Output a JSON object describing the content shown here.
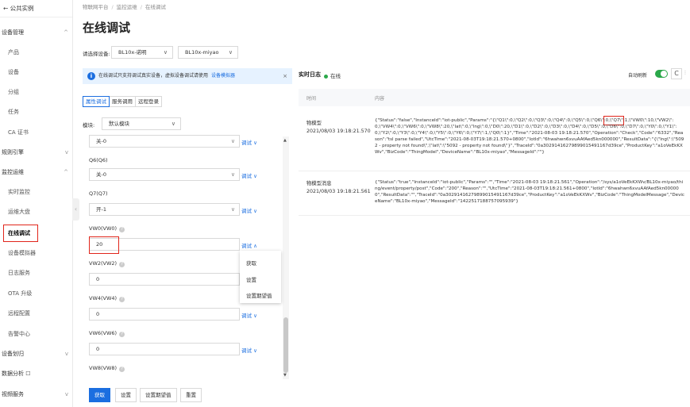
{
  "sidebar": {
    "back_label": "← 公共实例",
    "items": [
      {
        "label": "设备管理",
        "type": "group",
        "chevron": "^"
      },
      {
        "label": "产品",
        "type": "sub"
      },
      {
        "label": "设备",
        "type": "sub"
      },
      {
        "label": "分组",
        "type": "sub"
      },
      {
        "label": "任务",
        "type": "sub"
      },
      {
        "label": "CA 证书",
        "type": "sub"
      },
      {
        "label": "规则引擎",
        "type": "group",
        "chevron": "v"
      },
      {
        "label": "监控运维",
        "type": "group",
        "chevron": "^"
      },
      {
        "label": "实时监控",
        "type": "sub"
      },
      {
        "label": "运维大盘",
        "type": "sub"
      },
      {
        "label": "在线调试",
        "type": "active"
      },
      {
        "label": "设备模拟器",
        "type": "sub"
      },
      {
        "label": "日志服务",
        "type": "sub"
      },
      {
        "label": "OTA 升级",
        "type": "sub"
      },
      {
        "label": "远程配置",
        "type": "sub"
      },
      {
        "label": "告警中心",
        "type": "sub"
      },
      {
        "label": "设备划归",
        "type": "group",
        "chevron": "v"
      },
      {
        "label": "数据分析 ☐",
        "type": "group"
      },
      {
        "label": "视频服务",
        "type": "group",
        "chevron": "v"
      }
    ]
  },
  "breadcrumb": [
    "物联网平台",
    "监控运维",
    "在线调试"
  ],
  "page_title": "在线调试",
  "device_select": {
    "label": "请选择设备:",
    "product": "BL10x-诺明",
    "device": "BL10x-miyao"
  },
  "banner": {
    "text": "在线调试只支持调试真实设备，虚拟设备调试请使用",
    "link": "设备模拟器",
    "close": "×"
  },
  "tabs": [
    "属性调试",
    "服务调用",
    "远程登录"
  ],
  "module": {
    "label": "模块:",
    "value": "默认模块"
  },
  "fields": [
    {
      "label": "",
      "value": "关-0",
      "kind": "select"
    },
    {
      "label": "Q6(Q6)",
      "value": "关-0",
      "kind": "select"
    },
    {
      "label": "Q7(Q7)",
      "value": "开-1",
      "kind": "select"
    },
    {
      "label": "VW0(VW0)",
      "value": "20",
      "kind": "input"
    },
    {
      "label": "VW2(VW2)",
      "value": "0",
      "kind": "input"
    },
    {
      "label": "VW4(VW4)",
      "value": "0",
      "kind": "input"
    },
    {
      "label": "VW6(VW6)",
      "value": "0",
      "kind": "input"
    },
    {
      "label": "VW8(VW8)",
      "value": "",
      "kind": "input"
    }
  ],
  "debug_label": "调试",
  "dropdown": [
    "获取",
    "设置",
    "设置期望值"
  ],
  "buttons": [
    "获取",
    "设置",
    "设置期望值",
    "重置"
  ],
  "log": {
    "title": "实时日志",
    "status": "在线",
    "auto_refresh": "自动刷新",
    "refresh": "C",
    "more": "⫶",
    "columns": [
      "时间",
      "内容"
    ],
    "rows": [
      {
        "type": "物模型",
        "time": "2021/08/03 19:18:21.570",
        "content": "{\"Status\":\"false\",\"InstanceId\":\"iot-public\",\"Params\":\"{\\\"Q1\\\":0,\\\"Q2\\\":0,\\\"Q3\\\":0,\\\"Q4\\\":0,\\\"Q5\\\":0,\\\"Q6\\\":0,\\\"Q7\\\":1,\\\"VW0\\\":10,\\\"VW2\\\":0,\\\"VW4\\\":0,\\\"VW6\\\":0,\\\"VW8\\\":20,\\\"lat\\\":0,\\\"lng\\\":0,\\\"D0\\\":20,\\\"D1\\\":0,\\\"D2\\\":0,\\\"D3\\\":0,\\\"D4\\\":0,\\\"D5\\\":0,\\\"D6\\\":0,\\\"D7\\\":0,\\\"Y0\\\":0,\\\"Y1\\\":0,\\\"Y2\\\":0,\\\"Y3\\\":0,\\\"Y4\\\":0,\\\"Y5\\\":0,\\\"Y6\\\":0,\\\"Y7\\\":1,\\\"Q0\\\":1}\",\"Time\":\"2021-08-03 19:18:21.570\",\"Operation\":\"Check\",\"Code\":\"6332\",\"Reason\":\"tsl parse failed\",\"UtcTime\":\"2021-08-03T19:18:21.570+0800\",\"IotId\":\"6hwahwn6xvuAAfAed5kn000000\",\"ResultData\":\"{\\\"lng\\\":\\\"5092 - property not found\\\",\\\"lat\\\":\\\"5092 - property not found\\\"}\",\"TraceId\":\"0a30291416279899015491167d39ce\",\"ProductKey\":\"a1oVeEkKXWv\",\"BizCode\":\"ThingModel\",\"DeviceName\":\"BL10x-miyao\",\"MessageId\":\"\"}"
      },
      {
        "type": "物模型消息",
        "time": "2021/08/03 19:18:21.561",
        "content": "{\"Status\":\"true\",\"InstanceId\":\"iot-public\",\"Params\":\"\",\"Time\":\"2021-08-03 19:18:21.561\",\"Operation\":\"/sys/a1oVeEkKXWv/BL10x-miyao/thing/event/property/post\",\"Code\":\"200\",\"Reason\":\"\",\"UtcTime\":\"2021-08-03T19:18:21.561+0800\",\"IotId\":\"6hwahwn6xvuAAfAed5kn000000\",\"ResultData\":\"\",\"TraceId\":\"0a30291416279899015491167d39ce\",\"ProductKey\":\"a1oVeEkKXWv\",\"BizCode\":\"ThingModelMessage\",\"DeviceName\":\"BL10x-miyao\",\"MessageId\":\"1422517188757095939\"}"
      }
    ]
  },
  "colors": {
    "accent": "#1b6ee0",
    "highlight": "#e1251b",
    "online": "#2ba84a"
  }
}
